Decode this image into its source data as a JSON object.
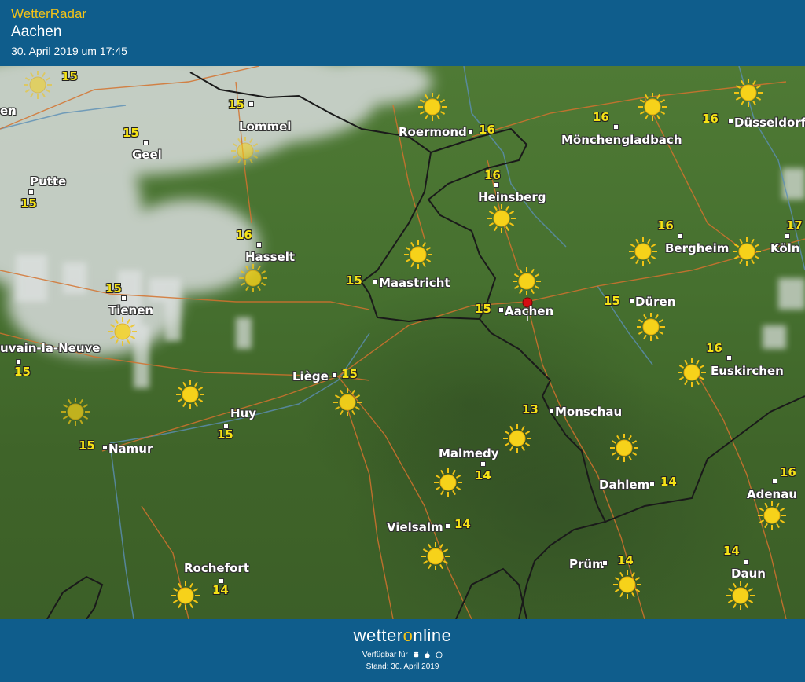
{
  "header": {
    "app_title": "WetterRadar",
    "city": "Aachen",
    "timestamp": "30. April 2019 um 17:45"
  },
  "footer": {
    "brand_prefix": "wetter",
    "brand_o": "o",
    "brand_suffix": "nline",
    "available": "Verfügbar für",
    "stand": "Stand: 30. April 2019",
    "platform_icons": [
      "android-icon",
      "apple-icon",
      "web-icon"
    ]
  },
  "colors": {
    "header_bg": "#0f5d8c",
    "title_accent": "#f3c318",
    "temp_text": "#f5e216",
    "terrain": "#46702f",
    "sun": "#f6d21a"
  },
  "cities": {
    "lommel": {
      "name": "Lommel",
      "temp": "15"
    },
    "geel": {
      "name": "Geel",
      "temp": "15"
    },
    "putte": {
      "name": "Putte",
      "temp": "15"
    },
    "hasselt": {
      "name": "Hasselt",
      "temp": "16"
    },
    "tienen": {
      "name": "Tienen",
      "temp": "15"
    },
    "louvain": {
      "name": "uvain-la-Neuve",
      "temp": "15"
    },
    "liege": {
      "name": "Liège",
      "temp": "15"
    },
    "huy": {
      "name": "Huy",
      "temp": "15"
    },
    "namur": {
      "name": "Namur",
      "temp": "15"
    },
    "rochefort": {
      "name": "Rochefort",
      "temp": "14"
    },
    "roermond": {
      "name": "Roermond",
      "temp": "16"
    },
    "moenchengladbach": {
      "name": "Mönchengladbach",
      "temp": "16"
    },
    "duesseldorf": {
      "name": "Düsseldorf",
      "temp": "16"
    },
    "heinsberg": {
      "name": "Heinsberg",
      "temp": "16"
    },
    "maastricht": {
      "name": "Maastricht",
      "temp": "15"
    },
    "aachen": {
      "name": "Aachen",
      "temp": "15"
    },
    "dueren": {
      "name": "Düren",
      "temp": "15"
    },
    "bergheim": {
      "name": "Bergheim",
      "temp": "16"
    },
    "koeln": {
      "name": "Köln",
      "temp": "17"
    },
    "euskirchen": {
      "name": "Euskirchen",
      "temp": "16"
    },
    "monschau": {
      "name": "Monschau",
      "temp": "13"
    },
    "malmedy": {
      "name": "Malmedy",
      "temp": "14"
    },
    "vielsalm": {
      "name": "Vielsalm",
      "temp": "14"
    },
    "dahlem": {
      "name": "Dahlem",
      "temp": "14"
    },
    "pruem": {
      "name": "Prüm",
      "temp": "14"
    },
    "adenau": {
      "name": "Adenau",
      "temp": "16"
    },
    "daun": {
      "name": "Daun",
      "temp": "14"
    },
    "cut_left": {
      "name": "en",
      "temp": ""
    },
    "cut_top": {
      "name": "",
      "temp": "15"
    }
  }
}
